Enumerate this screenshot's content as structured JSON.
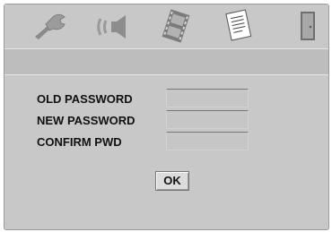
{
  "toolbar": {
    "items": [
      {
        "icon": "wrench-icon"
      },
      {
        "icon": "speaker-icon"
      },
      {
        "icon": "film-icon"
      },
      {
        "icon": "document-icon",
        "selected": true
      },
      {
        "icon": "door-icon"
      }
    ]
  },
  "form": {
    "old_password_label": "OLD PASSWORD",
    "new_password_label": "NEW PASSWORD",
    "confirm_password_label": "CONFIRM PWD",
    "old_password_value": "",
    "new_password_value": "",
    "confirm_password_value": ""
  },
  "buttons": {
    "ok_label": "OK"
  }
}
